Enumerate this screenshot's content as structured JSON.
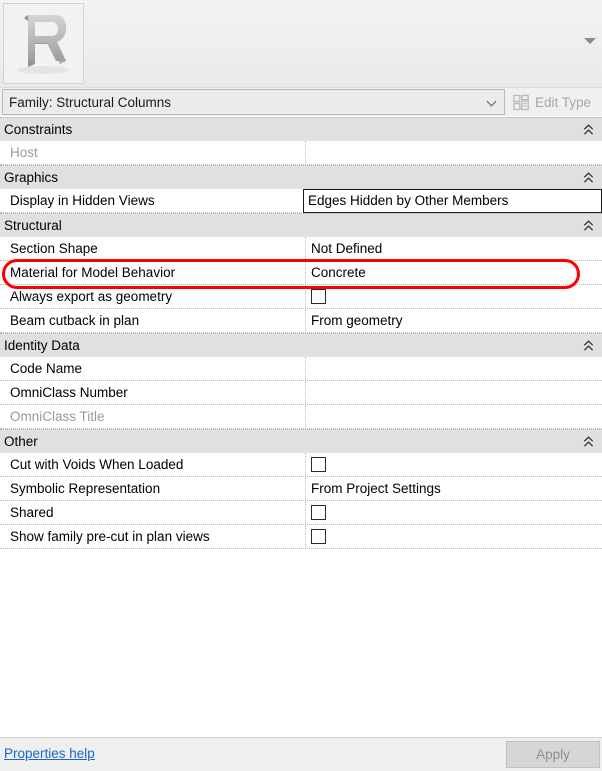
{
  "header": {
    "thumbnail_icon": "revit-r-logo",
    "collapse_caret_icon": "caret-down-icon"
  },
  "selector": {
    "family_value": "Family: Structural Columns",
    "dropdown_icon": "chevron-down-icon",
    "edit_type_label": "Edit Type",
    "edit_type_icon": "edit-type-grid-icon",
    "edit_type_enabled": false
  },
  "sections": [
    {
      "title": "Constraints",
      "collapse_icon": "double-chevron-up-icon",
      "rows": [
        {
          "name": "Host",
          "value": "",
          "type": "text",
          "disabled": true,
          "active": false,
          "highlighted": false
        }
      ]
    },
    {
      "title": "Graphics",
      "collapse_icon": "double-chevron-up-icon",
      "rows": [
        {
          "name": "Display in Hidden Views",
          "value": "Edges Hidden by Other Members",
          "type": "text",
          "disabled": false,
          "active": true,
          "highlighted": false
        }
      ]
    },
    {
      "title": "Structural",
      "collapse_icon": "double-chevron-up-icon",
      "rows": [
        {
          "name": "Section Shape",
          "value": "Not Defined",
          "type": "text",
          "disabled": false,
          "active": false,
          "highlighted": false
        },
        {
          "name": "Material for Model Behavior",
          "value": "Concrete",
          "type": "text",
          "disabled": false,
          "active": false,
          "highlighted": true
        },
        {
          "name": "Always export as geometry",
          "value": "",
          "type": "checkbox",
          "checked": false,
          "disabled": false,
          "active": false,
          "highlighted": false
        },
        {
          "name": "Beam cutback in plan",
          "value": "From geometry",
          "type": "text",
          "disabled": false,
          "active": false,
          "highlighted": false
        }
      ]
    },
    {
      "title": "Identity Data",
      "collapse_icon": "double-chevron-up-icon",
      "rows": [
        {
          "name": "Code Name",
          "value": "",
          "type": "text",
          "disabled": false,
          "active": false,
          "highlighted": false
        },
        {
          "name": "OmniClass Number",
          "value": "",
          "type": "text",
          "disabled": false,
          "active": false,
          "highlighted": false
        },
        {
          "name": "OmniClass Title",
          "value": "",
          "type": "text",
          "disabled": true,
          "active": false,
          "highlighted": false
        }
      ]
    },
    {
      "title": "Other",
      "collapse_icon": "double-chevron-up-icon",
      "rows": [
        {
          "name": "Cut with Voids When Loaded",
          "value": "",
          "type": "checkbox",
          "checked": false,
          "disabled": false,
          "active": false,
          "highlighted": false
        },
        {
          "name": "Symbolic Representation",
          "value": "From Project Settings",
          "type": "text",
          "disabled": false,
          "active": false,
          "highlighted": false
        },
        {
          "name": "Shared",
          "value": "",
          "type": "checkbox",
          "checked": false,
          "disabled": false,
          "active": false,
          "highlighted": false
        },
        {
          "name": "Show family pre-cut in plan views",
          "value": "",
          "type": "checkbox",
          "checked": false,
          "disabled": false,
          "active": false,
          "highlighted": false
        }
      ]
    }
  ],
  "footer": {
    "help_link": "Properties help",
    "apply_label": "Apply",
    "apply_enabled": false
  },
  "colors": {
    "highlight": "#ff0000",
    "link": "#1569c7",
    "section_header_bg": "#e0e0e0"
  }
}
